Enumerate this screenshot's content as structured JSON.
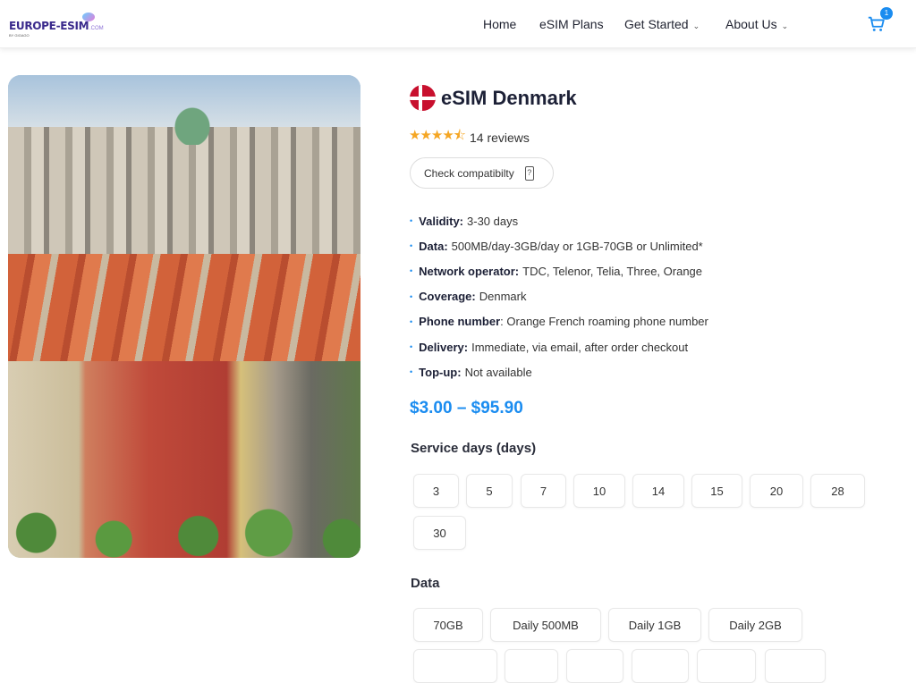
{
  "header": {
    "logo_text": "EUROPE-ESIM",
    "logo_suffix": ".COM",
    "logo_by": "BY GIGAGO",
    "nav": [
      {
        "label": "Home"
      },
      {
        "label": "eSIM Plans"
      },
      {
        "label": "Get Started",
        "dropdown": true
      },
      {
        "label": "About Us",
        "dropdown": true
      }
    ],
    "cart_count": "1",
    "cart_icon": "cart-icon"
  },
  "product": {
    "title": "eSIM Denmark",
    "flag": "denmark-flag",
    "rating": 4.5,
    "stars": "★★★★⯪",
    "reviews": "14 reviews",
    "check_label": "Check compatibilty",
    "specs": [
      {
        "k": "Validity:",
        "v": "3-30 days"
      },
      {
        "k": "Data:",
        "v": "500MB/day-3GB/day or 1GB-70GB or Unlimited*"
      },
      {
        "k": "Network operator:",
        "v": "TDC, Telenor, Telia, Three, Orange"
      },
      {
        "k": "Coverage:",
        "v": "Denmark"
      },
      {
        "k": "Phone number",
        "v": ": Orange French roaming phone number"
      },
      {
        "k": "Delivery:",
        "v": "Immediate, via email, after order checkout"
      },
      {
        "k": "Top-up:",
        "v": "Not available"
      }
    ],
    "price": "$3.00 – $95.90",
    "service_days_label": "Service days (days)",
    "service_days": [
      "3",
      "5",
      "7",
      "10",
      "14",
      "15",
      "20",
      "28",
      "30"
    ],
    "data_label": "Data",
    "data_options": [
      "70GB",
      "Daily 500MB",
      "Daily 1GB",
      "Daily 2GB"
    ]
  },
  "colors": {
    "accent": "#1a8cf0",
    "star": "#f5a623",
    "flag_red": "#c8102e"
  }
}
